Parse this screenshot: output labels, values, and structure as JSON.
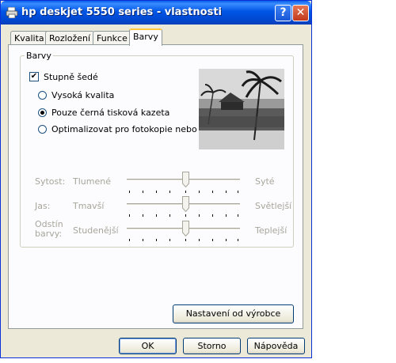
{
  "window": {
    "title": "hp deskjet 5550 series - vlastnosti",
    "help_glyph": "?",
    "close_glyph": "✕"
  },
  "tabs": [
    {
      "label": "Kvalita",
      "active": false
    },
    {
      "label": "Rozložení",
      "active": false
    },
    {
      "label": "Funkce",
      "active": false
    },
    {
      "label": "Barvy",
      "active": true
    }
  ],
  "group": {
    "label": "Barvy",
    "grayscale": {
      "label": "Stupně šedé",
      "checked": true
    },
    "options": [
      {
        "label": "Vysoká kvalita",
        "selected": false
      },
      {
        "label": "Pouze černá tisková kazeta",
        "selected": true
      },
      {
        "label": "Optimalizovat pro fotokopie nebo fax",
        "selected": false
      }
    ],
    "sliders": [
      {
        "label": "Sytost:",
        "left": "Tlumené",
        "right": "Syté",
        "value": 0.5,
        "enabled": false
      },
      {
        "label": "Jas:",
        "left": "Tmavší",
        "right": "Světlejší",
        "value": 0.5,
        "enabled": false
      },
      {
        "label": "Odstín barvy:",
        "left": "Studenější",
        "right": "Teplejší",
        "value": 0.5,
        "enabled": false
      }
    ]
  },
  "buttons": {
    "defaults": "Nastavení od výrobce",
    "ok": "OK",
    "cancel": "Storno",
    "help": "Nápověda"
  },
  "colors": {
    "title_bar": "#0055e5",
    "dialog_bg": "#ece9d8",
    "tab_highlight": "#ffc83c"
  }
}
